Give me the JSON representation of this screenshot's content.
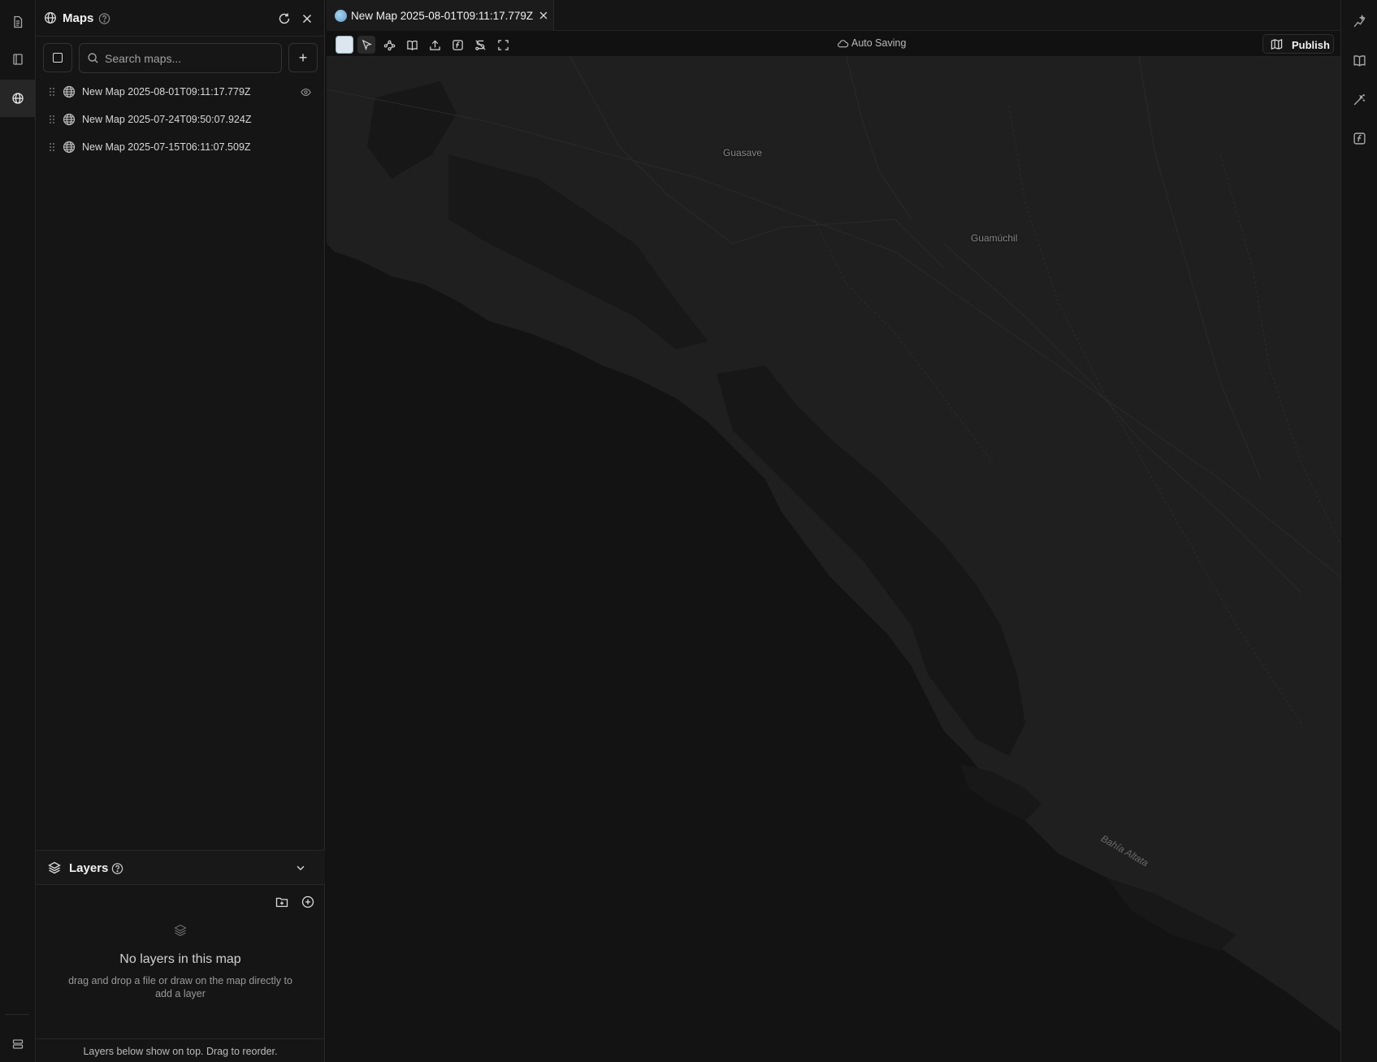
{
  "sidebar": {
    "title": "Maps",
    "search_placeholder": "Search maps...",
    "maps": [
      {
        "label": "New Map 2025-08-01T09:11:17.779Z",
        "visible_toggle": true
      },
      {
        "label": "New Map 2025-07-24T09:50:07.924Z",
        "visible_toggle": false
      },
      {
        "label": "New Map 2025-07-15T06:11:07.509Z",
        "visible_toggle": false
      }
    ]
  },
  "layers": {
    "title": "Layers",
    "empty_title": "No layers in this map",
    "empty_description": "drag and drop a file or draw on the map directly to add a layer",
    "footer": "Layers below show on top. Drag to reorder."
  },
  "tab": {
    "label": "New Map 2025-08-01T09:11:17.779Z"
  },
  "toolbar": {
    "autosave_label": "Auto Saving",
    "publish_label": "Publish"
  },
  "map": {
    "labels": {
      "city1": "Guasave",
      "city2": "Guamúchil",
      "bay": "Bahía Altata"
    }
  },
  "colors": {
    "background": "#111112",
    "panel": "#151515",
    "land": "#1f1f20",
    "water": "#131313"
  }
}
